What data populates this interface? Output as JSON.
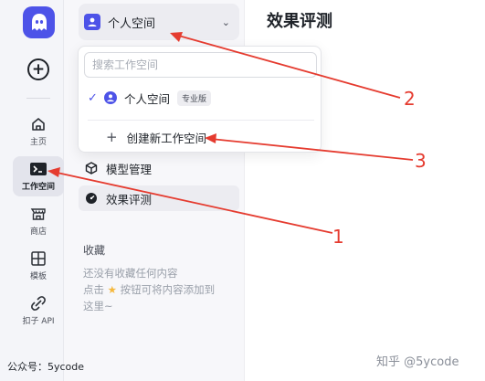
{
  "rail": {
    "items": [
      {
        "label": "主页",
        "icon": "home-icon"
      },
      {
        "label": "工作空间",
        "icon": "terminal-icon"
      },
      {
        "label": "商店",
        "icon": "store-icon"
      },
      {
        "label": "模板",
        "icon": "template-icon"
      },
      {
        "label": "扣子 API",
        "icon": "api-icon"
      }
    ]
  },
  "workspace_select": {
    "name": "个人空间"
  },
  "dropdown": {
    "search_placeholder": "搜索工作空间",
    "current": {
      "name": "个人空间",
      "badge": "专业版"
    },
    "create_label": "创建新工作空间"
  },
  "nav": {
    "items": [
      {
        "label": "模型管理",
        "icon": "cube-icon"
      },
      {
        "label": "效果评测",
        "icon": "gauge-icon"
      }
    ]
  },
  "favorites": {
    "title": "收藏",
    "empty_text_1": "还没有收藏任何内容",
    "empty_text_2_pre": "点击",
    "empty_text_2_post": "按钮可将内容添加到",
    "empty_text_3": "这里~"
  },
  "main": {
    "title": "效果评测"
  },
  "annotations": {
    "n1": "1",
    "n2": "2",
    "n3": "3"
  },
  "watermarks": {
    "left": "公众号：5ycode",
    "right": "知乎 @5ycode"
  },
  "colors": {
    "accent": "#4d53e8",
    "arrow": "#e53b2f"
  }
}
